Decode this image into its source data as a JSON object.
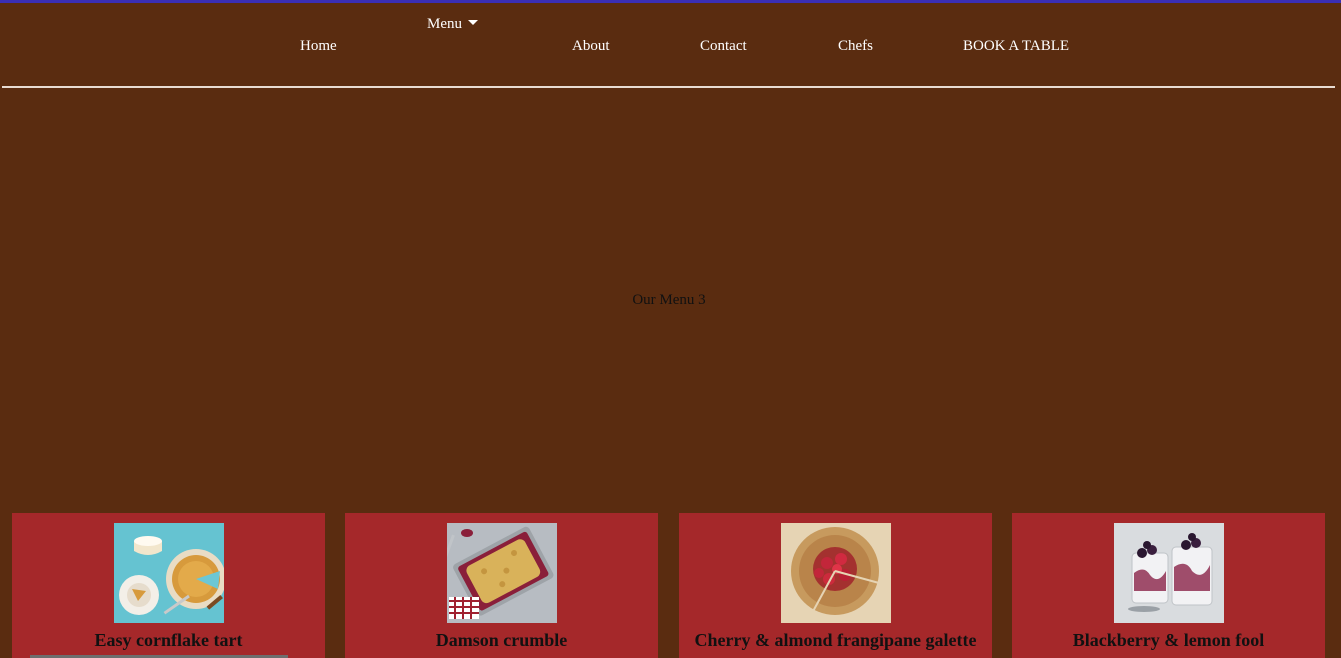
{
  "nav": {
    "home": "Home",
    "menu": "Menu",
    "about": "About",
    "contact": "Contact",
    "chefs": "Chefs",
    "book": "BOOK A TABLE"
  },
  "hero": {
    "text": "Our Menu 3"
  },
  "cards": [
    {
      "title": "Easy cornflake tart",
      "image": "tart-photo"
    },
    {
      "title": "Damson crumble",
      "image": "crumble-photo"
    },
    {
      "title": "Cherry & almond frangipane galette",
      "image": "galette-photo"
    },
    {
      "title": "Blackberry & lemon fool",
      "image": "fool-photo"
    }
  ],
  "colors": {
    "background": "#5a2c10",
    "card": "#a5282a",
    "accent": "#3a2fb5"
  }
}
